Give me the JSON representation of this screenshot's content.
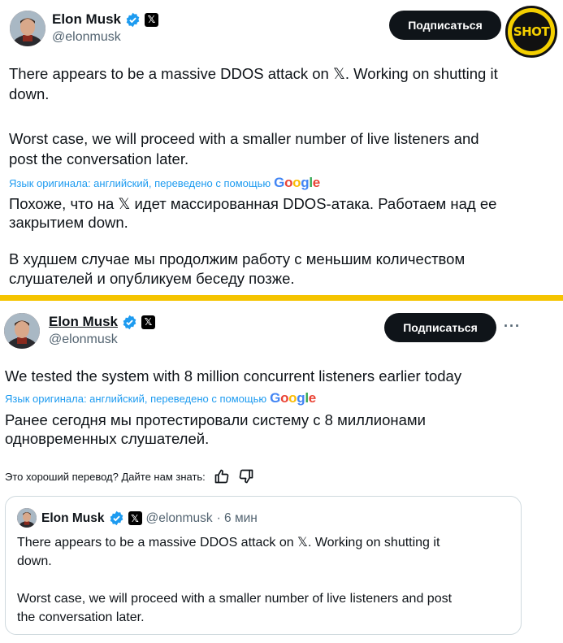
{
  "tweet1": {
    "author_name": "Elon Musk",
    "author_handle": "@elonmusk",
    "subscribe_label": "Подписаться",
    "text_line1": "There appears to be a massive DDOS attack on 𝕏. Working on shutting it",
    "text_line2": "down.",
    "text_line3": "Worst case, we will proceed with a smaller number of live listeners and",
    "text_line4": "post the conversation later.",
    "translate_note": "Язык оригинала: английский, переведено с помощью",
    "translated_line1": "Похоже, что на 𝕏 идет массированная DDOS-атака. Работаем над ее",
    "translated_line2": "закрытием down.",
    "translated_line3": "В худшем случае мы продолжим работу с меньшим количеством",
    "translated_line4": "слушателей и опубликуем беседу позже."
  },
  "logo": {
    "text": "SHOT"
  },
  "google": {
    "g1": "G",
    "o1": "o",
    "o2": "o",
    "g2": "g",
    "l": "l",
    "e": "e"
  },
  "tweet2": {
    "author_name": "Elon Musk",
    "author_handle": "@elonmusk",
    "subscribe_label": "Подписаться",
    "more_label": "···",
    "text": "We tested the system with 8 million concurrent listeners earlier today",
    "translate_note": "Язык оригинала: английский, переведено с помощью",
    "translated_line1": "Ранее сегодня мы протестировали систему с 8 миллионами",
    "translated_line2": "одновременных слушателей.",
    "feedback_prompt": "Это хороший перевод? Дайте нам знать:"
  },
  "quote": {
    "author_name": "Elon Musk",
    "author_handle": "@elonmusk",
    "time": "· 6 мин",
    "text": "There appears to be a massive DDOS attack on 𝕏. Working on shutting it\ndown.\n\nWorst case, we will proceed with a smaller number of live listeners and post\nthe conversation later."
  },
  "colors": {
    "accent": "#1d9bf0",
    "divider": "#f5c400",
    "button": "#0f1419"
  },
  "icons": [
    "verified-icon",
    "x-badge-icon",
    "more-icon",
    "thumbs-up-icon",
    "thumbs-down-icon"
  ]
}
